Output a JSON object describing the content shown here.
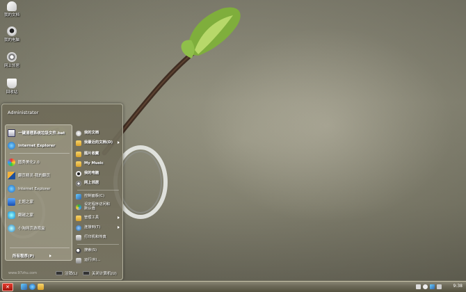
{
  "desktop": {
    "icons": [
      {
        "label": "我的文档",
        "icon": "my-documents-icon"
      },
      {
        "label": "我的电脑",
        "icon": "my-computer-icon"
      },
      {
        "label": "网上邻居",
        "icon": "network-places-icon"
      },
      {
        "label": "回收站",
        "icon": "recycle-bin-icon"
      }
    ]
  },
  "start_menu": {
    "user_name": "Administrator",
    "pinned_programs": [
      {
        "label": "一键清理系统垃圾文件.bat",
        "icon": "batch-file-icon"
      },
      {
        "label": "Internet Explorer",
        "icon": "ie-icon"
      }
    ],
    "recent_programs": [
      {
        "label": "圆秀美化2.0",
        "icon": "meihua-icon"
      },
      {
        "label": "翻页精灵-我的翻页",
        "icon": "flip-icon"
      },
      {
        "label": "Internet Explorer",
        "icon": "ie-icon"
      },
      {
        "label": "主题之家",
        "icon": "theme-home-icon"
      },
      {
        "label": "翻越之家",
        "icon": "fanyue-icon"
      },
      {
        "label": "小淘网页游戏盒",
        "icon": "game-box-icon"
      }
    ],
    "all_programs_label": "所有程序(P)",
    "watermark": "www.97zhu.com",
    "right_items": [
      {
        "label": "我的文档",
        "icon": "folder-icon",
        "bold": true,
        "arrow": false
      },
      {
        "label": "我最近的文档(D)",
        "icon": "folder-icon",
        "bold": true,
        "arrow": true
      },
      {
        "label": "图片收藏",
        "icon": "pictures-icon",
        "bold": true,
        "arrow": false
      },
      {
        "label": "My Music",
        "icon": "music-icon",
        "bold": true,
        "arrow": false
      },
      {
        "label": "我的电脑",
        "icon": "computer-icon",
        "bold": true,
        "arrow": false
      },
      {
        "label": "网上邻居",
        "icon": "network-icon",
        "bold": true,
        "arrow": false
      },
      {
        "label": "控制面板(C)",
        "icon": "control-panel-icon",
        "bold": false,
        "arrow": false
      },
      {
        "label": "设定程序访问和默认值",
        "icon": "program-access-icon",
        "bold": false,
        "arrow": false
      },
      {
        "label": "管理工具",
        "icon": "admin-tools-icon",
        "bold": false,
        "arrow": true
      },
      {
        "label": "连接到(T)",
        "icon": "connect-icon",
        "bold": false,
        "arrow": true
      },
      {
        "label": "打印机和传真",
        "icon": "printer-icon",
        "bold": false,
        "arrow": false
      },
      {
        "label": "搜索(S)",
        "icon": "search-icon",
        "bold": false,
        "arrow": false
      },
      {
        "label": "运行(R)...",
        "icon": "run-icon",
        "bold": false,
        "arrow": false
      }
    ],
    "logoff_label": "注销(L)",
    "shutdown_label": "关闭计算机(U)"
  },
  "taskbar": {
    "start_icon": "start-logo-icon",
    "quick_launch": [
      "show-desktop-icon",
      "ie-icon",
      "folder-icon"
    ],
    "tray_icons": [
      "keyboard-icon",
      "help-icon",
      "network-tray-icon",
      "volume-icon"
    ],
    "clock": "9:38"
  },
  "colors": {
    "start_button": "#c4261a",
    "taskbar": "#6c6958",
    "menu_panel": "#6e6a58"
  }
}
